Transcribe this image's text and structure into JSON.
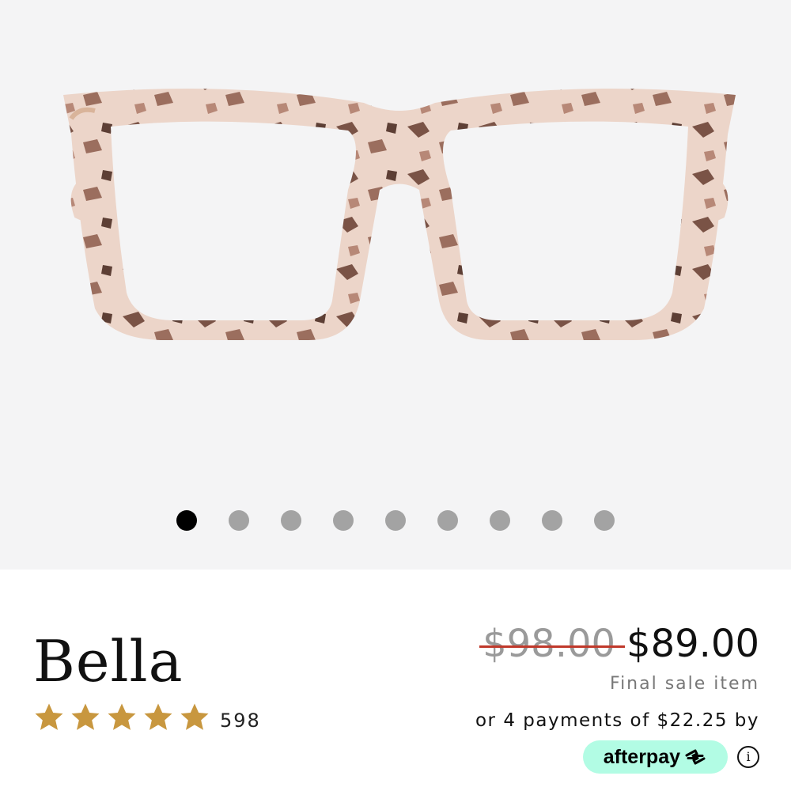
{
  "product": {
    "name": "Bella",
    "rating": 5,
    "review_count": "598"
  },
  "gallery": {
    "slide_count": 9,
    "active_index": 0
  },
  "pricing": {
    "original_price": "$98.00",
    "sale_price": "$89.00",
    "note": "Final sale item",
    "installments_text": "or 4 payments of $22.25 by",
    "afterpay_label": "afterpay"
  },
  "icons": {
    "star": "star-icon",
    "afterpay": "afterpay-arrows-icon",
    "info": "info-icon"
  },
  "colors": {
    "star": "#c8973f",
    "strike": "#c0392b",
    "afterpay_bg": "#b2fce4",
    "dot_active": "#000000",
    "dot_inactive": "#a3a3a3"
  }
}
